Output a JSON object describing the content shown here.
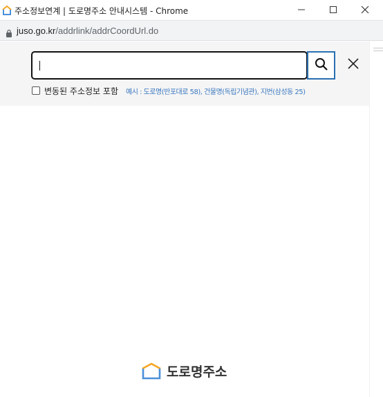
{
  "window": {
    "title": "주소정보연계 | 도로명주소 안내시스템 - Chrome",
    "app_icon": "house-logo-icon",
    "controls": [
      "minimize-icon",
      "maximize-icon",
      "close-icon"
    ]
  },
  "addressbar": {
    "host": "juso.go.kr",
    "path": "/addrlink/addrCoordUrl.do"
  },
  "search": {
    "value": "",
    "placeholder": "",
    "button_icon": "search-icon",
    "close_icon": "close-icon",
    "checkbox_label": "변동된 주소정보 포함",
    "checkbox_checked": false,
    "example": "예시 : 도로명(반포대로 58), 건물명(독립기념관), 지번(삼성동 25)",
    "accent_color": "#2a6fb0",
    "example_color": "#3b78c0"
  },
  "footer": {
    "logo_text": "도로명주소",
    "logo_icon": "house-logo-icon",
    "logo_colors": [
      "#4a90d9",
      "#f5a623"
    ]
  }
}
